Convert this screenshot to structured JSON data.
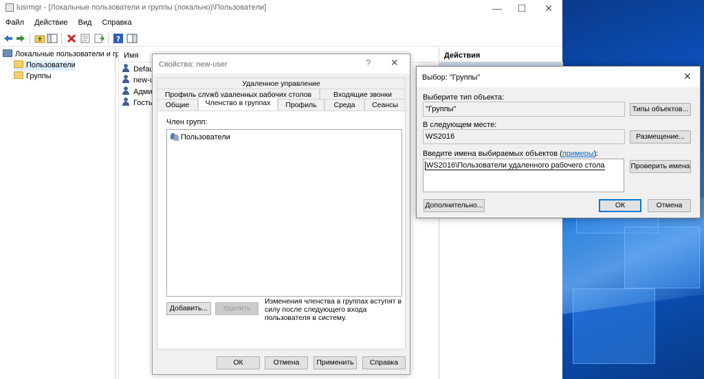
{
  "window": {
    "title": "lusrmgr - [Локальные пользователи и группы (локально)\\Пользователи]",
    "minimize": "—",
    "maximize": "☐",
    "close": "✕"
  },
  "menu": [
    "Файл",
    "Действие",
    "Вид",
    "Справка"
  ],
  "tree": {
    "root": "Локальные пользователи и гру",
    "items": [
      "Пользователи",
      "Группы"
    ]
  },
  "list": {
    "column_name": "Имя",
    "rows": [
      "Defaul",
      "new-u",
      "Админ",
      "Гость"
    ]
  },
  "actions": {
    "header": "Действия"
  },
  "props_dialog": {
    "title": "Свойства: new-user",
    "help": "?",
    "close": "✕",
    "tabs_row1": [
      "Удаленное управление"
    ],
    "tabs_row2": [
      "Профиль служб удаленных рабочих столов",
      "Входящие звонки"
    ],
    "tabs_row3": [
      "Общие",
      "Членство в группах",
      "Профиль",
      "Среда",
      "Сеансы"
    ],
    "member_of_label": "Член групп:",
    "groups": [
      "Пользователи"
    ],
    "add_button": "Добавить...",
    "remove_button": "Удалить",
    "note": [
      "Изменения членства в группах вступят в",
      "силу после следующего входа",
      "пользователя в систему."
    ],
    "ok": "ОК",
    "cancel": "Отмена",
    "apply": "Применить",
    "help_button": "Справка"
  },
  "select_dialog": {
    "title": "Выбор: \"Группы\"",
    "close": "✕",
    "object_type_label": "Выберите тип объекта:",
    "object_type_value": "\"Группы\"",
    "object_types_button": "Типы объектов...",
    "location_label": "В следующем месте:",
    "location_value": "WS2016",
    "locations_button": "Размещение...",
    "names_label_prefix": "Введите имена выбираемых объектов (",
    "names_label_link": "примеры",
    "names_label_suffix": "):",
    "names_value": "WS2016\\Пользователи удаленного рабочего стола",
    "check_names_button": "Проверить имена",
    "advanced_button": "Дополнительно...",
    "ok": "ОК",
    "cancel": "Отмена"
  }
}
